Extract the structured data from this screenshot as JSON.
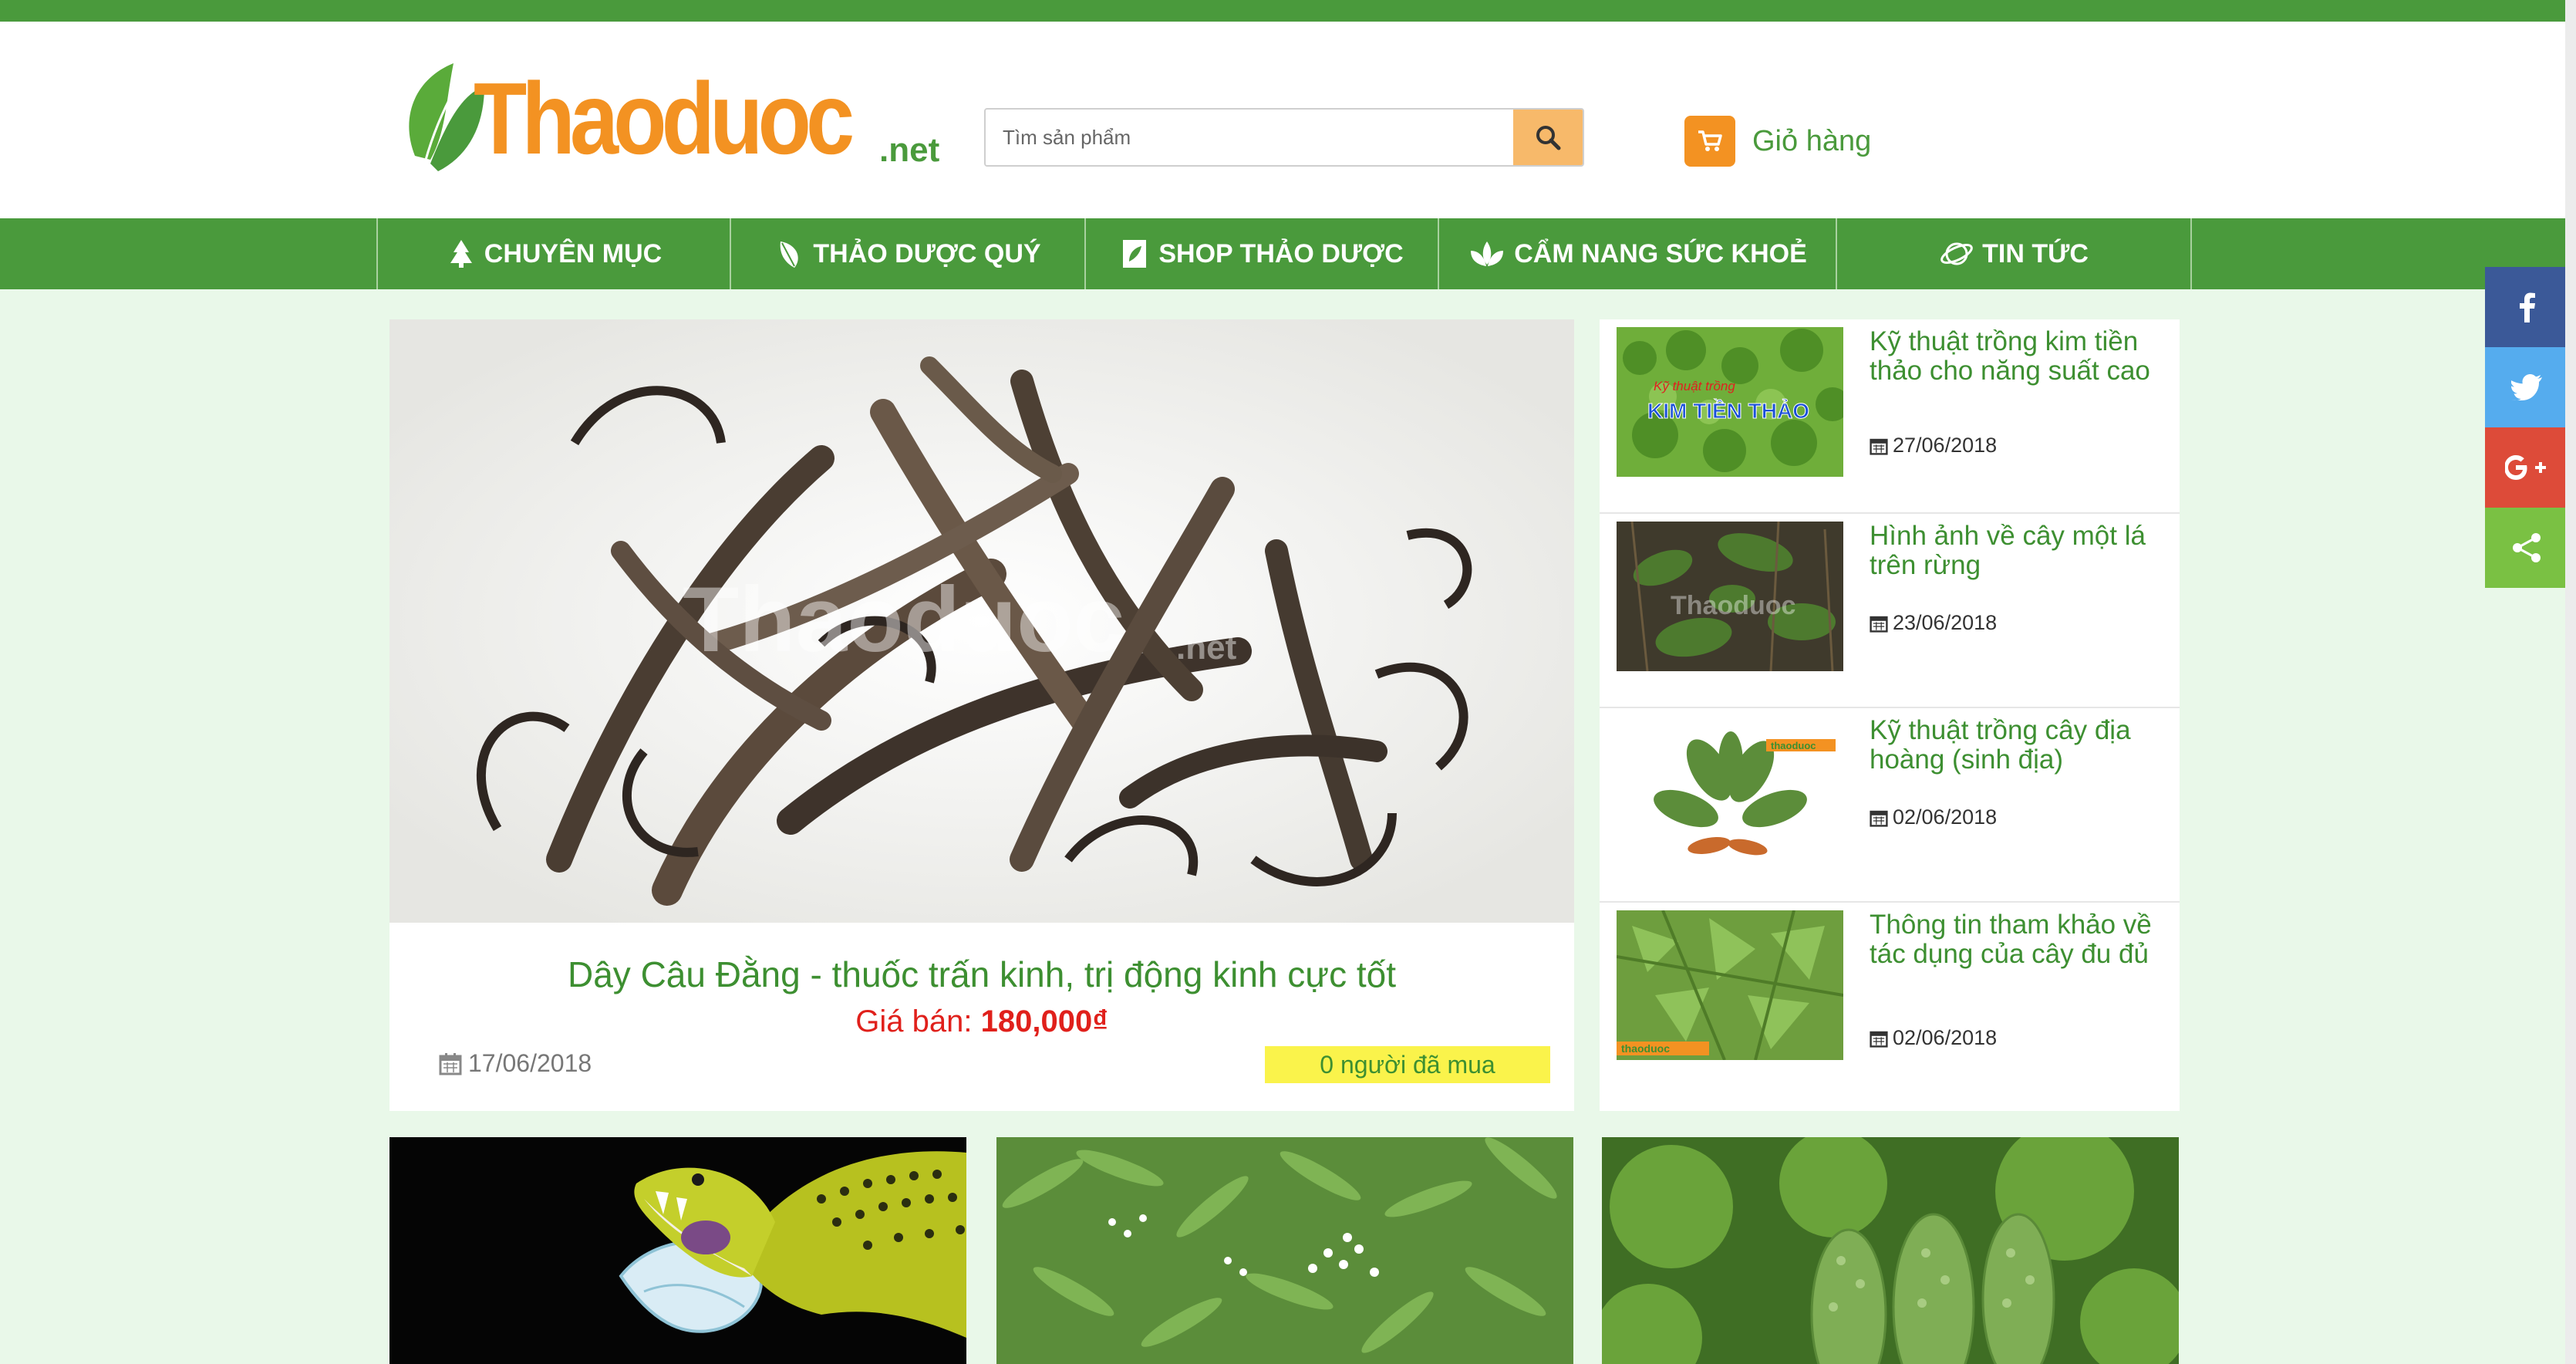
{
  "header": {
    "logo_text": "Thaoduoc",
    "logo_suffix": ".net",
    "search_placeholder": "Tìm sản phẩm",
    "cart_label": "Giỏ hàng"
  },
  "nav": {
    "items": [
      {
        "label": "CHUYÊN MỤC",
        "icon": "tree-icon"
      },
      {
        "label": "THẢO DƯỢC QUÝ",
        "icon": "leaf-icon"
      },
      {
        "label": "SHOP THẢO DƯỢC",
        "icon": "herb-shop-icon"
      },
      {
        "label": "CẨM NANG SỨC KHOẺ",
        "icon": "lotus-icon"
      },
      {
        "label": "TIN TỨC",
        "icon": "planet-icon"
      }
    ]
  },
  "featured": {
    "title": "Dây Câu Đằng - thuốc trấn kinh, trị động kinh cực tốt",
    "price_label": "Giá bán:",
    "price_value": "180,000₫",
    "date": "17/06/2018",
    "buyers": "0 người đã mua"
  },
  "news": [
    {
      "title": "Kỹ thuật trồng kim tiền thảo cho năng suất cao",
      "date": "27/06/2018",
      "thumb_caption_small": "Kỹ thuật trồng",
      "thumb_caption_big": "KIM TIỀN THẢO"
    },
    {
      "title": "Hình ảnh về cây một lá trên rừng",
      "date": "23/06/2018"
    },
    {
      "title": "Kỹ thuật trồng cây địa hoàng (sinh địa)",
      "date": "02/06/2018"
    },
    {
      "title": "Thông tin tham khảo về tác dụng của cây đu đủ",
      "date": "02/06/2018"
    }
  ],
  "share": {
    "items": [
      "facebook-icon",
      "twitter-icon",
      "google-plus-icon",
      "share-icon"
    ],
    "colors": [
      "#3b5998",
      "#55acee",
      "#dd4b39",
      "#7ac143"
    ]
  },
  "colors": {
    "brand_green": "#4a9a3c",
    "brand_orange": "#f39222",
    "price_red": "#e0201b",
    "page_bg": "#e9f8e9"
  }
}
